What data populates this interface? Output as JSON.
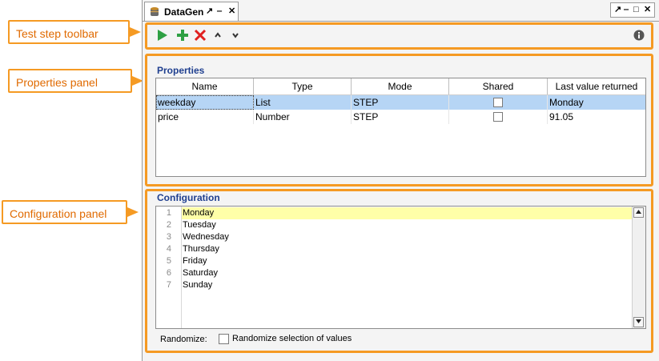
{
  "callouts": {
    "toolbar": "Test step toolbar",
    "properties": "Properties panel",
    "configuration": "Configuration panel"
  },
  "tab": {
    "title": "DataGen",
    "controls": [
      "↗",
      "‒",
      "✕"
    ]
  },
  "window_controls": [
    "↗",
    "‒",
    "□",
    "✕"
  ],
  "toolbar": {
    "run_icon": "run-icon",
    "add_icon": "add-icon",
    "delete_icon": "delete-icon",
    "move_up_icon": "move-up-icon",
    "move_down_icon": "move-down-icon",
    "info_icon": "info-icon"
  },
  "properties": {
    "title": "Properties",
    "columns": [
      "Name",
      "Type",
      "Mode",
      "Shared",
      "Last value returned"
    ],
    "rows": [
      {
        "name": "weekday",
        "type": "List",
        "mode": "STEP",
        "shared": false,
        "last": "Monday"
      },
      {
        "name": "price",
        "type": "Number",
        "mode": "STEP",
        "shared": false,
        "last": "91.05"
      }
    ]
  },
  "configuration": {
    "title": "Configuration",
    "lines": [
      "Monday",
      "Tuesday",
      "Wednesday",
      "Thursday",
      "Friday",
      "Saturday",
      "Sunday"
    ],
    "line_numbers": [
      "1",
      "2",
      "3",
      "4",
      "5",
      "6",
      "7"
    ],
    "randomize_label": "Randomize:",
    "randomize_option": "Randomize selection of values",
    "randomize_checked": false
  },
  "colors": {
    "accent": "#f59a23",
    "panel_title": "#1f3f8f",
    "selection": "#b6d5f5",
    "current_line": "#ffffa8"
  }
}
